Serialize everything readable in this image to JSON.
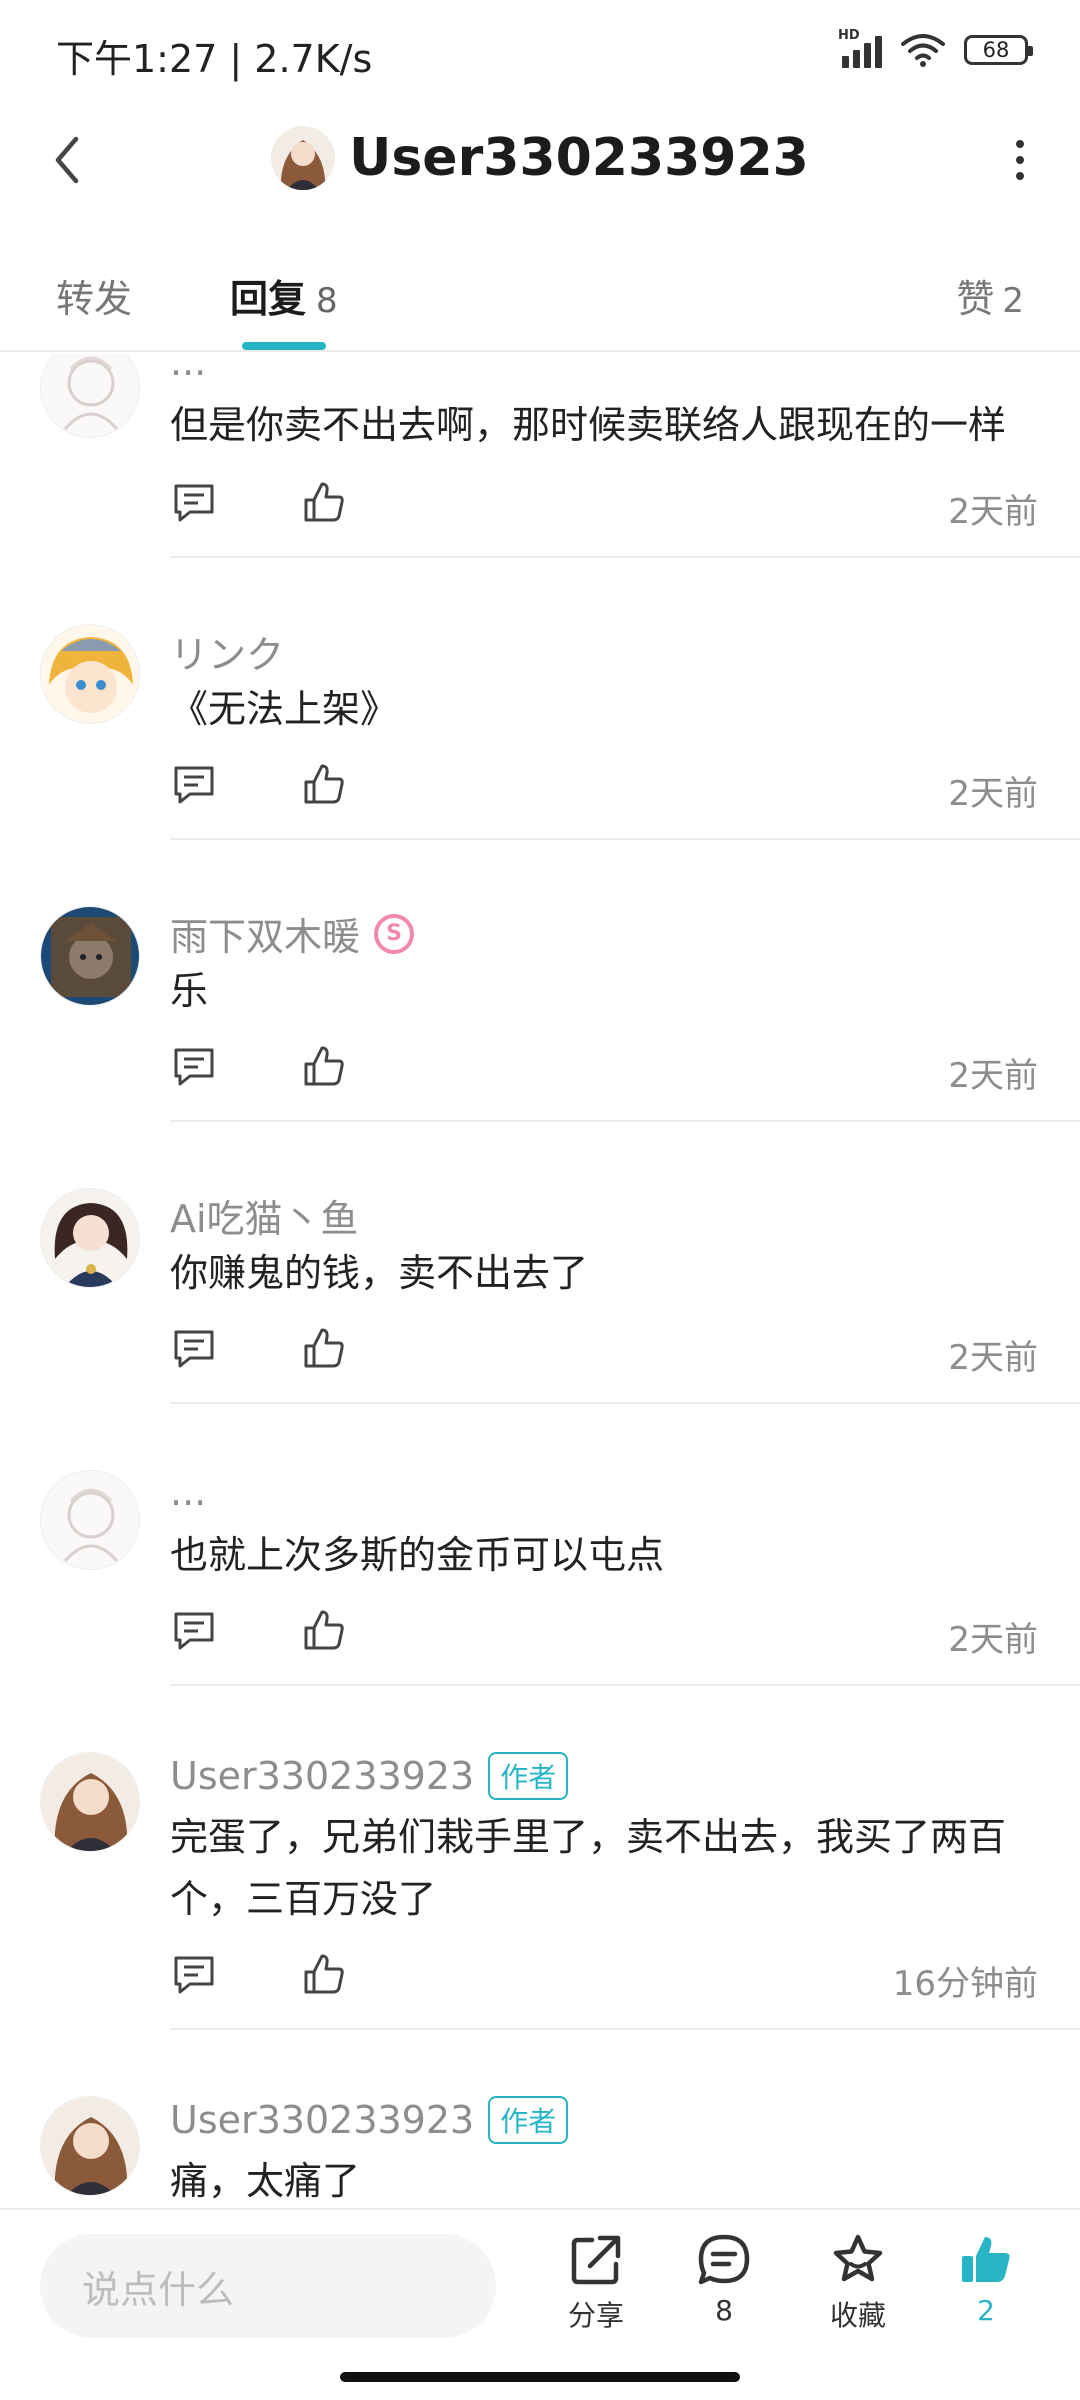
{
  "status_bar": {
    "time": "下午1:27 | 2.7K/s",
    "network_label": "HD",
    "battery": "68",
    "icons": [
      "signal-icon",
      "wifi-icon",
      "battery-icon"
    ]
  },
  "header": {
    "title": "User330233923",
    "back_icon": "chevron-left-icon",
    "more_icon": "more-vertical-icon"
  },
  "tabs": {
    "forward": {
      "label": "转发"
    },
    "reply": {
      "label": "回复",
      "count": "8"
    },
    "like": {
      "label": "赞",
      "count": "2"
    }
  },
  "comments": [
    {
      "name": "...",
      "text": "但是你卖不出去啊，那时候卖联络人跟现在的一样",
      "time": "2天前",
      "author": false
    },
    {
      "name": "リンク",
      "text": "《无法上架》",
      "time": "2天前",
      "author": false
    },
    {
      "name": "雨下双木暖",
      "text": "乐",
      "time": "2天前",
      "author": false,
      "vip_badge": "S"
    },
    {
      "name": "Ai吃猫丶鱼",
      "text": "你赚鬼的钱，卖不出去了",
      "time": "2天前",
      "author": false
    },
    {
      "name": "...",
      "text": "也就上次多斯的金币可以屯点",
      "time": "2天前",
      "author": false
    },
    {
      "name": "User330233923",
      "badge": "作者",
      "text": "完蛋了，兄弟们栽手里了，卖不出去，我买了两百个，三百万没了",
      "time": "16分钟前",
      "author": true
    },
    {
      "name": "User330233923",
      "badge": "作者",
      "text": "痛，太痛了",
      "time": "",
      "author": true
    }
  ],
  "bottom_bar": {
    "input_placeholder": "说点什么",
    "share_label": "分享",
    "reply_count": "8",
    "favorite_label": "收藏",
    "like_count": "2"
  },
  "colors": {
    "accent": "#27b5c6",
    "secondary_text": "#8d8d8d",
    "vip_pink": "#f08aa8"
  }
}
